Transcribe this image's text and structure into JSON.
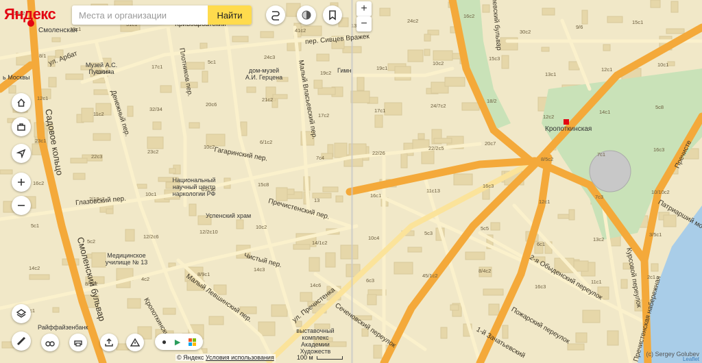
{
  "app": {
    "logo": "Яндекс"
  },
  "search": {
    "placeholder": "Места и организации",
    "button": "Найти"
  },
  "zoom": {
    "in": "+",
    "out": "−"
  },
  "metro": [
    {
      "name": "Смоленская"
    },
    {
      "name": "Кропоткинская"
    }
  ],
  "pois": [
    {
      "name": "Музей А.С. Пушкина"
    },
    {
      "name": "дом-музей А.И. Герцена"
    },
    {
      "name": "Национальный научный центр наркологии РФ"
    },
    {
      "name": "Успенский храм"
    },
    {
      "name": "Медицинское училище № 13"
    },
    {
      "name": "Райффайзенбанк"
    },
    {
      "name": "выставочный комплекс Академии Художеств"
    },
    {
      "name": "Гимн"
    },
    {
      "name": "ь Москвы"
    }
  ],
  "streets": [
    "ул. Арбат",
    "Кривоарбатский",
    "Плотников пер.",
    "пер. Сивцев Вражек",
    "Малый Власьевский пер.",
    "Денежный пер.",
    "Гагаринский пер.",
    "Глазовский пер.",
    "Пречистенский пер.",
    "Чистый пер.",
    "Малый Левшинский пер.",
    "Кропоткинский",
    "ул. Пречистенка",
    "Сеченовский переулок",
    "Садовое кольцо",
    "Смоленский бульвар",
    "2-я Обыденский переулок",
    "Пожарский переулок",
    "1-й Зачатьевский",
    "Курсовой переулок",
    "Пречистенская набережная",
    "Патриарший мост",
    "Пречисте",
    "пер. Сивцев Вражек",
    "Гоголевский бульвар"
  ],
  "building_labels": [
    "13c2",
    "15c1",
    "51c1",
    "42c5",
    "41c6",
    "41c2",
    "13c1",
    "24c2",
    "16c2",
    "30c2",
    "9/6",
    "15c1",
    "8/1",
    "26/9c1",
    "17с1",
    "5c1",
    "24c3",
    "19c2",
    "19c1",
    "10c2",
    "15c3",
    "13c1",
    "12c1",
    "10c1",
    "12с1",
    "11c2",
    "32/34",
    "20c6",
    "21c2",
    "17c2",
    "17c1",
    "24/7c2",
    "18/2",
    "12c2",
    "14c1",
    "5c8",
    "23c1",
    "22c3",
    "23c2",
    "10c2",
    "6/1c2",
    "7c4",
    "22/26",
    "22/2c5",
    "20c7",
    "8/5c2",
    "7с1",
    "16c3",
    "16c2",
    "2/18c7",
    "10c1",
    "15c10",
    "15c8",
    "13",
    "16c1",
    "11c13",
    "16c3",
    "12c1",
    "7c3",
    "10/10c2",
    "5c1",
    "5c2",
    "12/2c6",
    "12/2c10",
    "10c2",
    "14/1c2",
    "10c4",
    "5c3",
    "5c5",
    "6c1",
    "13c2",
    "3/5c1",
    "14c2",
    "8/2c2",
    "4c2",
    "8/9c1",
    "14c3",
    "14c6",
    "6c3",
    "45/1c2",
    "8/4c2",
    "16c3",
    "11c1",
    "2c1",
    "1c1"
  ],
  "controls": {
    "credit": "(c) Sergey Golubev",
    "leaflet": "Leaflet"
  },
  "footer": {
    "copyright": "© Яндекс",
    "terms": "Условия использования",
    "scale": "100 м"
  },
  "colors": {
    "land": "#f1e8c8",
    "block": "#e8dbb1",
    "building": "#d9ca9e",
    "road_major": "#f6ab3c",
    "road_secondary": "#fbe9a6",
    "park": "#c7e3bb",
    "water": "#a9cde8",
    "metro": "#e30613",
    "search_button": "#ffdb4d"
  }
}
